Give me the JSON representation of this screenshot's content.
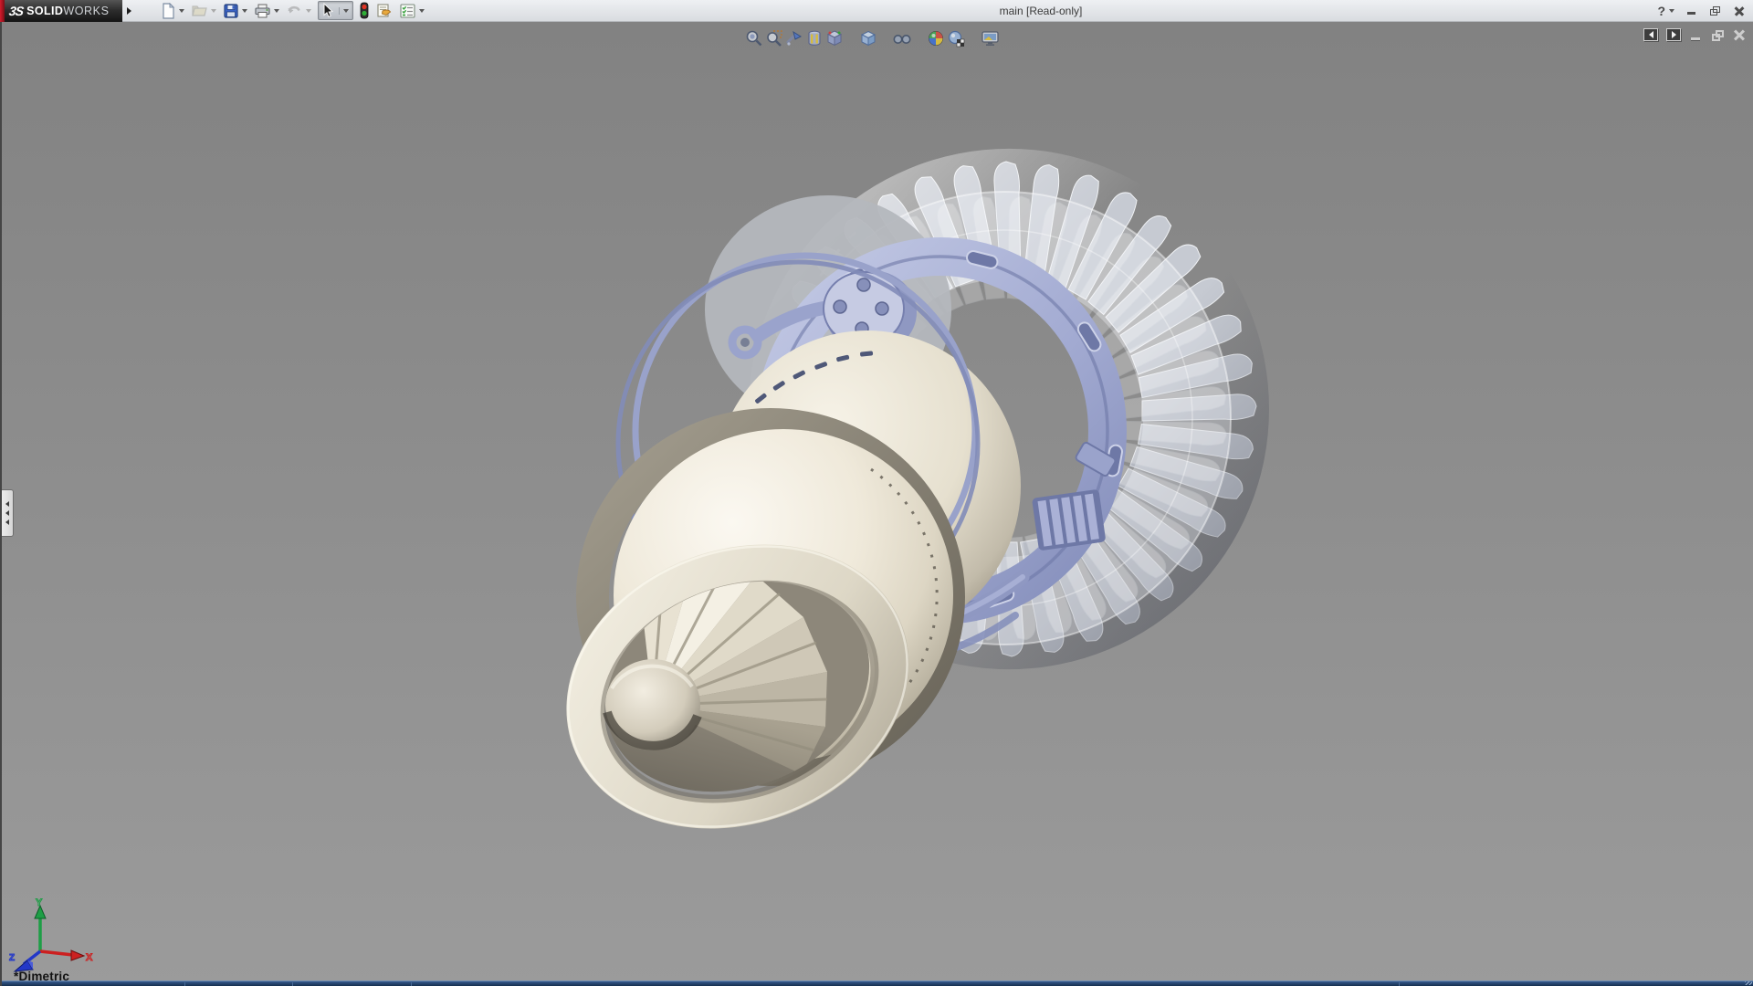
{
  "window": {
    "title": "main [Read-only]",
    "brand": {
      "glyph": "3S",
      "name_bold": "SOLID",
      "name_light": "WORKS"
    },
    "help_label": "?"
  },
  "main_toolbar": {
    "items": [
      {
        "id": "new",
        "icon": "new-document-icon",
        "has_dropdown": true,
        "enabled": true
      },
      {
        "id": "open",
        "icon": "open-folder-icon",
        "has_dropdown": true,
        "enabled": false
      },
      {
        "id": "save",
        "icon": "save-icon",
        "has_dropdown": true,
        "enabled": true
      },
      {
        "id": "print",
        "icon": "print-icon",
        "has_dropdown": true,
        "enabled": true
      },
      {
        "id": "undo",
        "icon": "undo-icon",
        "has_dropdown": true,
        "enabled": false
      },
      {
        "id": "select",
        "icon": "select-cursor-icon",
        "has_dropdown": true,
        "enabled": true,
        "active": true
      },
      {
        "id": "rebuild",
        "icon": "rebuild-traffic-light-icon",
        "has_dropdown": false,
        "enabled": true
      },
      {
        "id": "file-properties",
        "icon": "file-properties-icon",
        "has_dropdown": false,
        "enabled": true
      },
      {
        "id": "options",
        "icon": "options-icon",
        "has_dropdown": true,
        "enabled": true
      }
    ]
  },
  "heads_up_toolbar": {
    "items": [
      "zoom-to-fit",
      "zoom-to-area",
      "previous-view",
      "section-view",
      "view-orientation",
      "display-style",
      "hide-show-items",
      "edit-appearance",
      "apply-scene",
      "view-settings"
    ]
  },
  "viewport": {
    "orientation_label": "*Dimetric",
    "triad": {
      "x_label": "X",
      "y_label": "Y",
      "z_label": "Z",
      "x_color": "#cc2020",
      "y_color": "#1e9e46",
      "z_color": "#2338c8"
    },
    "model": {
      "name": "jet-engine-assembly",
      "fan_blade_count": 36,
      "ghost_blade_count": 36,
      "colors": {
        "body_cream": "#e9e3d3",
        "casing_lavender": "#a7aed3",
        "blades_silver": "#c6cad2",
        "front_ring_gray": "#8e8878"
      }
    }
  },
  "status_bar": {
    "color": "#1d3a5f"
  },
  "colors": {
    "brand_red": "#c01625",
    "titlebar_bg": "#e2e5e9",
    "viewport_top": "#828282",
    "viewport_bottom": "#9b9b9b"
  }
}
